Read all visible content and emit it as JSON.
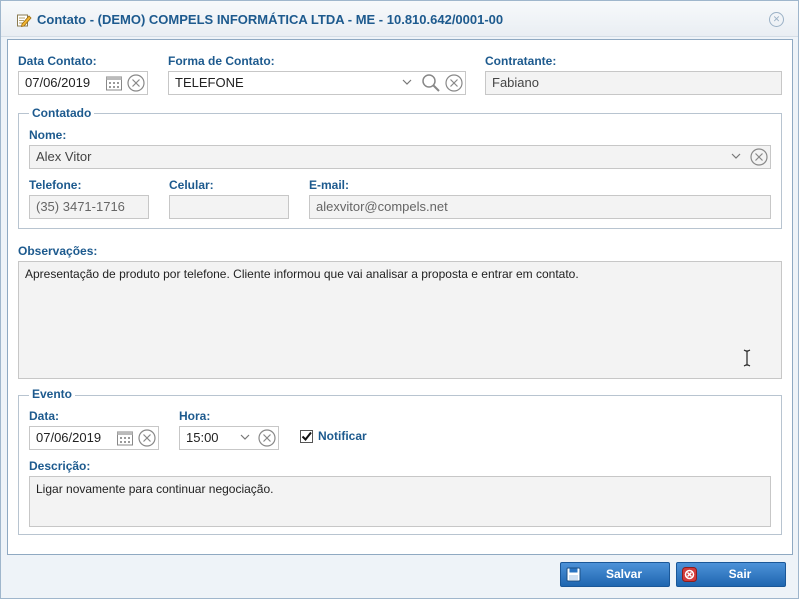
{
  "dialog": {
    "title": "Contato - (DEMO) COMPELS INFORMÁTICA LTDA - ME - 10.810.642/0001-00",
    "close_glyph": "✕"
  },
  "contato": {
    "data_label": "Data Contato:",
    "data_value": "07/06/2019",
    "forma_label": "Forma de Contato:",
    "forma_value": "TELEFONE",
    "contratante_label": "Contratante:",
    "contratante_value": "Fabiano"
  },
  "contatado": {
    "legend": "Contatado",
    "nome_label": "Nome:",
    "nome_value": "Alex Vitor",
    "telefone_label": "Telefone:",
    "telefone_value": "(35) 3471-1716",
    "celular_label": "Celular:",
    "celular_value": "",
    "email_label": "E-mail:",
    "email_value": "alexvitor@compels.net"
  },
  "observacoes": {
    "label": "Observações:",
    "value": "Apresentação de produto por telefone. Cliente informou que vai analisar a proposta e entrar em contato."
  },
  "evento": {
    "legend": "Evento",
    "data_label": "Data:",
    "data_value": "07/06/2019",
    "hora_label": "Hora:",
    "hora_value": "15:00",
    "notificar_label": "Notificar",
    "notificar_checked": true,
    "descricao_label": "Descrição:",
    "descricao_value": "Ligar novamente para continuar negociação."
  },
  "footer": {
    "save_label": "Salvar",
    "exit_label": "Sair"
  },
  "colors": {
    "accent": "#1d5a8e",
    "button": "#2a74c2",
    "danger": "#d23b3b"
  },
  "icons": {
    "title": "pencil-note-icon",
    "calendar": "calendar-icon",
    "clear": "clear-circle-icon",
    "dropdown": "chevron-down-icon",
    "search": "search-icon",
    "save": "floppy-disk-icon",
    "exit": "exit-icon"
  }
}
